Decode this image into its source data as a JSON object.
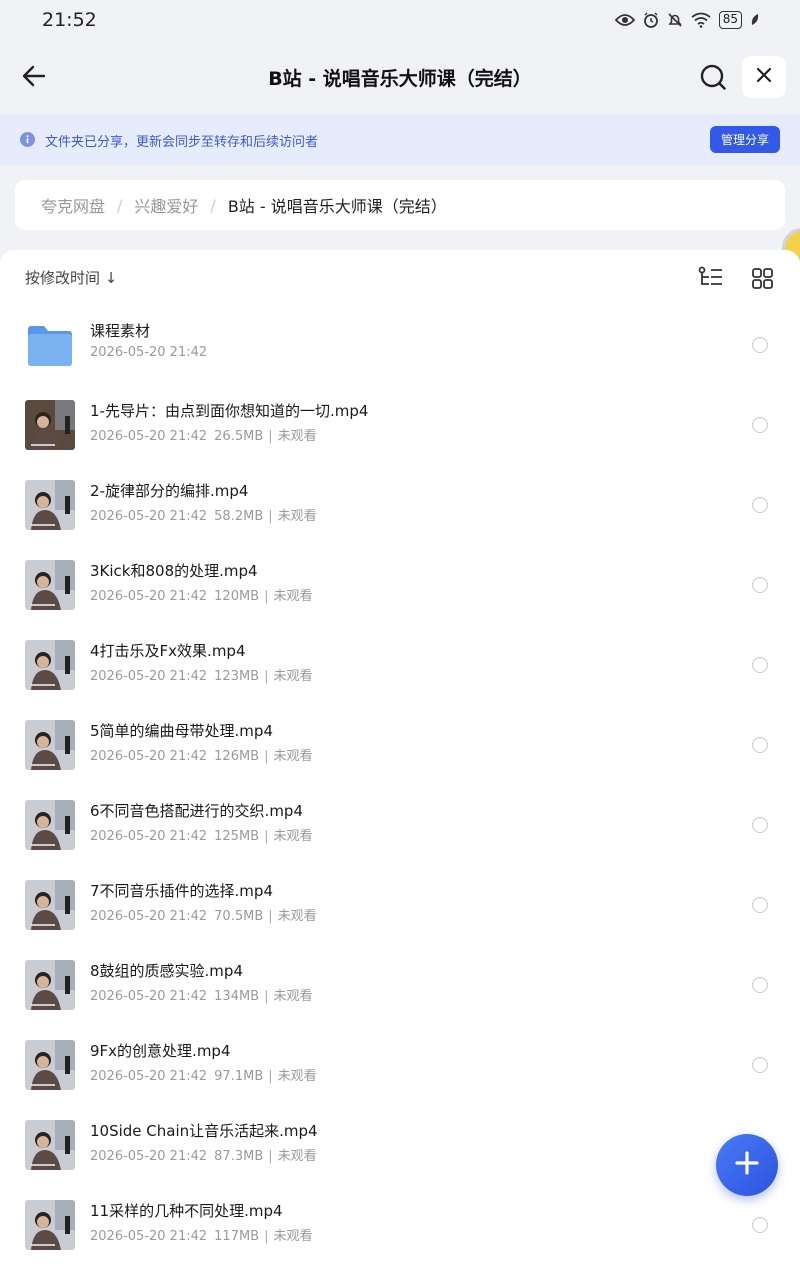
{
  "status_bar": {
    "time": "21:52",
    "battery": "85"
  },
  "header": {
    "title": "B站 - 说唱音乐大师课（完结）"
  },
  "notice": {
    "text": "文件夹已分享，更新会同步至转存和后续访问者",
    "button": "管理分享"
  },
  "breadcrumb": [
    "夸克网盘",
    "兴趣爱好",
    "B站 - 说唱音乐大师课（完结）"
  ],
  "breadcrumb_separator": "/",
  "sort": {
    "label": "按修改时间 ↓"
  },
  "meta_separator": "|",
  "files": [
    {
      "name": "课程素材",
      "date": "2026-05-20 21:42",
      "size": "",
      "status": "",
      "type": "folder"
    },
    {
      "name": "1-先导片：由点到面你想知道的一切.mp4",
      "date": "2026-05-20 21:42",
      "size": "26.5MB",
      "status": "未观看",
      "type": "video"
    },
    {
      "name": "2-旋律部分的编排.mp4",
      "date": "2026-05-20 21:42",
      "size": "58.2MB",
      "status": "未观看",
      "type": "video"
    },
    {
      "name": "3Kick和808的处理.mp4",
      "date": "2026-05-20 21:42",
      "size": "120MB",
      "status": "未观看",
      "type": "video"
    },
    {
      "name": "4打击乐及Fx效果.mp4",
      "date": "2026-05-20 21:42",
      "size": "123MB",
      "status": "未观看",
      "type": "video"
    },
    {
      "name": "5简单的编曲母带处理.mp4",
      "date": "2026-05-20 21:42",
      "size": "126MB",
      "status": "未观看",
      "type": "video"
    },
    {
      "name": "6不同音色搭配进行的交织.mp4",
      "date": "2026-05-20 21:42",
      "size": "125MB",
      "status": "未观看",
      "type": "video"
    },
    {
      "name": "7不同音乐插件的选择.mp4",
      "date": "2026-05-20 21:42",
      "size": "70.5MB",
      "status": "未观看",
      "type": "video"
    },
    {
      "name": "8鼓组的质感实验.mp4",
      "date": "2026-05-20 21:42",
      "size": "134MB",
      "status": "未观看",
      "type": "video"
    },
    {
      "name": "9Fx的创意处理.mp4",
      "date": "2026-05-20 21:42",
      "size": "97.1MB",
      "status": "未观看",
      "type": "video"
    },
    {
      "name": "10Side Chain让音乐活起来.mp4",
      "date": "2026-05-20 21:42",
      "size": "87.3MB",
      "status": "未观看",
      "type": "video"
    },
    {
      "name": "11采样的几种不同处理.mp4",
      "date": "2026-05-20 21:42",
      "size": "117MB",
      "status": "未观看",
      "type": "video"
    }
  ],
  "colors": {
    "accent": "#3359e8",
    "notice_bg": "#e6ecfb",
    "folder": "#6aa7ee"
  }
}
